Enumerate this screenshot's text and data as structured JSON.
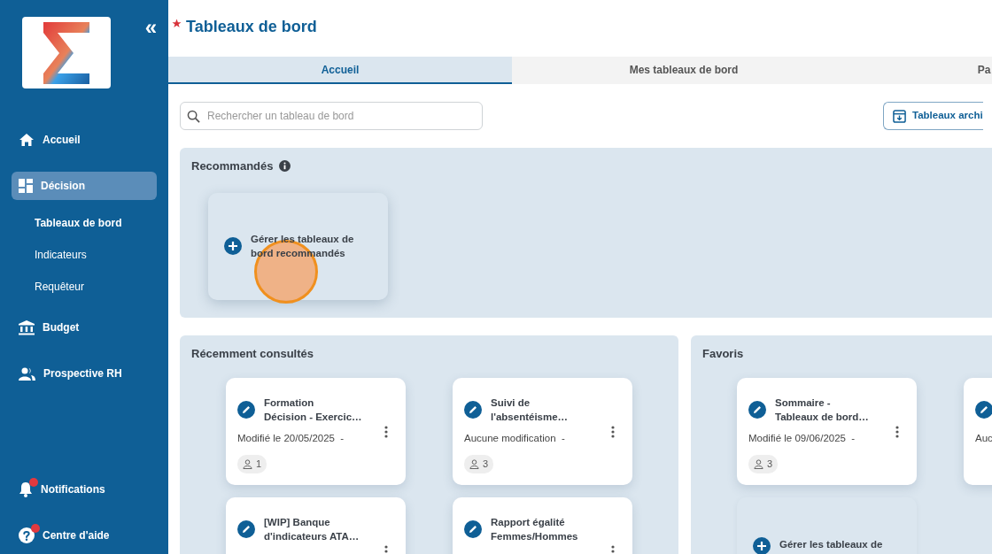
{
  "sidebar": {
    "collapse": "«",
    "items": [
      {
        "kind": "home",
        "label": "Accueil",
        "selected": false
      },
      {
        "kind": "grid",
        "label": "Décision",
        "selected": true,
        "children": [
          {
            "label": "Tableaux de bord",
            "selected": true
          },
          {
            "label": "Indicateurs",
            "selected": false
          },
          {
            "label": "Requêteur",
            "selected": false
          }
        ]
      },
      {
        "kind": "bank",
        "label": "Budget",
        "selected": false
      },
      {
        "kind": "people",
        "label": "Prospective RH",
        "selected": false
      }
    ],
    "bottom_items": [
      {
        "kind": "bell",
        "label": "Notifications",
        "unread": true
      },
      {
        "kind": "help",
        "label": "Centre d'aide",
        "unread": true
      }
    ]
  },
  "header": {
    "title": "Tableaux de bord",
    "favorite": true
  },
  "tabs": [
    {
      "label": "Accueil",
      "selected": true
    },
    {
      "label": "Mes tableaux de bord",
      "selected": false
    },
    {
      "label": "Pa",
      "selected": false
    }
  ],
  "search": {
    "placeholder": "Rechercher un tableau de bord"
  },
  "archive_button": {
    "label": "Tableaux archi"
  },
  "recommended": {
    "title": "Recommandés",
    "info": true,
    "cards": [
      {
        "kind": "manage",
        "label": "Gérer les tableaux de bord recommandés",
        "click_highlight": true
      }
    ]
  },
  "recent": {
    "title": "Récemment consultés",
    "cards": [
      {
        "kind": "dashboard",
        "title": "Formation\nDécision - Exercic…",
        "modified": "Modifié le 20/05/2025  -",
        "users": "1"
      },
      {
        "kind": "dashboard",
        "title": "Suivi de\nl'absentéisme…",
        "modified": "Aucune modification  -",
        "users": "3"
      },
      {
        "kind": "dashboard",
        "title": "[WIP] Banque\nd'indicateurs ATA…"
      },
      {
        "kind": "dashboard",
        "title": "Rapport égalité\nFemmes/Hommes"
      }
    ]
  },
  "favorites": {
    "title": "Favoris",
    "cards": [
      {
        "kind": "dashboard",
        "title": "Sommaire -\nTableaux de bord…",
        "modified": "Modifié le 09/06/2025  -",
        "users": "3"
      },
      {
        "kind": "dashboard",
        "modified": "Auc"
      },
      {
        "kind": "manage",
        "label": "Gérer les tableaux de",
        "click_highlight": false
      }
    ]
  }
}
